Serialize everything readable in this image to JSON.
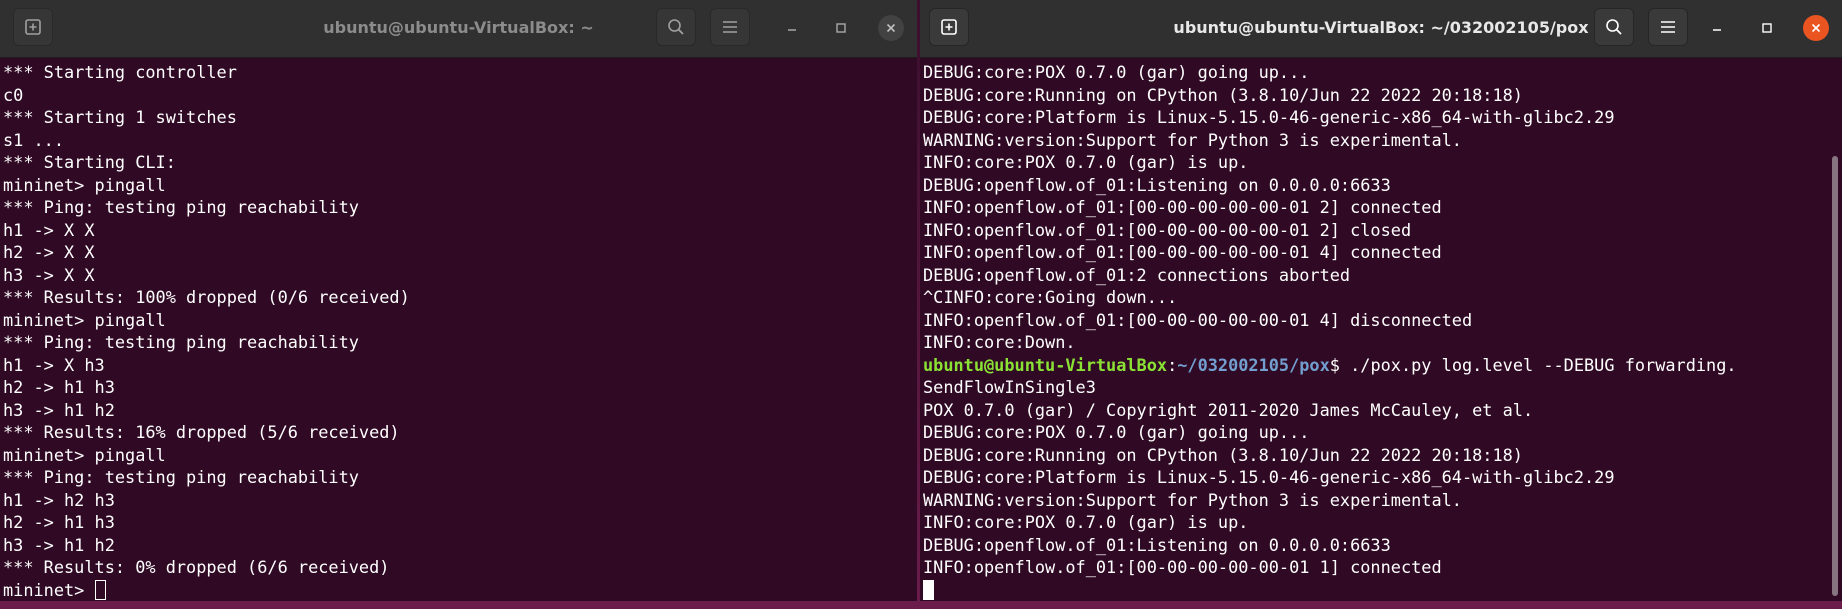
{
  "left_terminal": {
    "title": "ubuntu@ubuntu-VirtualBox: ~",
    "lines": [
      "*** Starting controller",
      "c0",
      "*** Starting 1 switches",
      "s1 ...",
      "*** Starting CLI:",
      "mininet> pingall",
      "*** Ping: testing ping reachability",
      "h1 -> X X",
      "h2 -> X X",
      "h3 -> X X",
      "*** Results: 100% dropped (0/6 received)",
      "mininet> pingall",
      "*** Ping: testing ping reachability",
      "h1 -> X h3",
      "h2 -> h1 h3",
      "h3 -> h1 h2",
      "*** Results: 16% dropped (5/6 received)",
      "mininet> pingall",
      "*** Ping: testing ping reachability",
      "h1 -> h2 h3",
      "h2 -> h1 h3",
      "h3 -> h1 h2",
      "*** Results: 0% dropped (6/6 received)"
    ],
    "prompt": "mininet> "
  },
  "right_terminal": {
    "title": "ubuntu@ubuntu-VirtualBox: ~/032002105/pox",
    "lines_before": [
      "DEBUG:core:POX 0.7.0 (gar) going up...",
      "DEBUG:core:Running on CPython (3.8.10/Jun 22 2022 20:18:18)",
      "DEBUG:core:Platform is Linux-5.15.0-46-generic-x86_64-with-glibc2.29",
      "WARNING:version:Support for Python 3 is experimental.",
      "INFO:core:POX 0.7.0 (gar) is up.",
      "DEBUG:openflow.of_01:Listening on 0.0.0.0:6633",
      "INFO:openflow.of_01:[00-00-00-00-00-01 2] connected",
      "INFO:openflow.of_01:[00-00-00-00-00-01 2] closed",
      "INFO:openflow.of_01:[00-00-00-00-00-01 4] connected",
      "DEBUG:openflow.of_01:2 connections aborted",
      "^CINFO:core:Going down...",
      "INFO:openflow.of_01:[00-00-00-00-00-01 4] disconnected",
      "INFO:core:Down."
    ],
    "prompt_user": "ubuntu@ubuntu-VirtualBox",
    "prompt_sep": ":",
    "prompt_path": "~/032002105/pox",
    "prompt_end": "$ ",
    "command": "./pox.py log.level --DEBUG forwarding.",
    "command_cont": "SendFlowInSingle3",
    "lines_after": [
      "POX 0.7.0 (gar) / Copyright 2011-2020 James McCauley, et al.",
      "DEBUG:core:POX 0.7.0 (gar) going up...",
      "DEBUG:core:Running on CPython (3.8.10/Jun 22 2022 20:18:18)",
      "DEBUG:core:Platform is Linux-5.15.0-46-generic-x86_64-with-glibc2.29",
      "WARNING:version:Support for Python 3 is experimental.",
      "INFO:core:POX 0.7.0 (gar) is up.",
      "DEBUG:openflow.of_01:Listening on 0.0.0.0:6633",
      "INFO:openflow.of_01:[00-00-00-00-00-01 1] connected"
    ]
  },
  "toolbar": {
    "new_tab_icon": "new-tab-icon",
    "search_icon": "search-icon",
    "menu_icon": "hamburger-menu-icon",
    "minimize_icon": "minimize-icon",
    "maximize_icon": "maximize-icon",
    "close_icon": "close-icon"
  },
  "colors": {
    "terminal_bg": "#300a24",
    "titlebar_bg": "#303030",
    "prompt_user": "#8ae234",
    "prompt_path": "#729fcf",
    "close_active": "#e95420"
  }
}
